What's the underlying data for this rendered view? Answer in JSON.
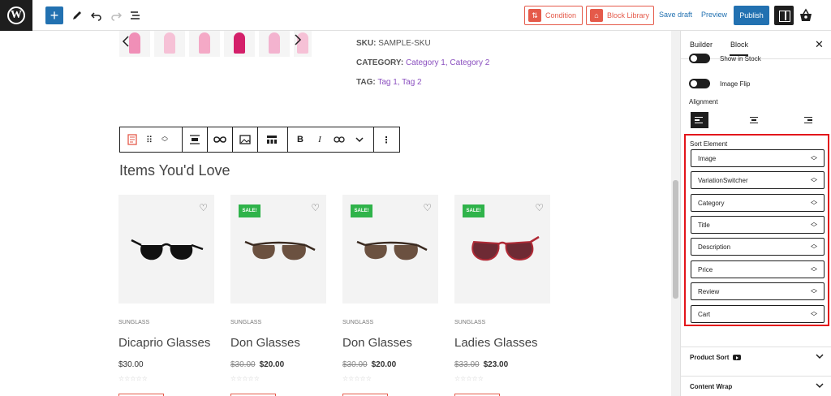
{
  "topbar": {
    "condition_label": "Condition",
    "block_library_label": "Block Library",
    "save_draft_label": "Save draft",
    "preview_label": "Preview",
    "publish_label": "Publish"
  },
  "product_meta": {
    "sku_key": "SKU:",
    "sku_value": "SAMPLE-SKU",
    "category_key": "CATEGORY:",
    "category_value": "Category 1, Category 2",
    "tag_key": "TAG:",
    "tag_value": "Tag 1, Tag 2"
  },
  "section_title": "Items You'd Love",
  "products": [
    {
      "category": "SUNGLASS",
      "name": "Dicaprio Glasses",
      "old_price": "",
      "price": "$30.00",
      "sale": false,
      "sale_label": ""
    },
    {
      "category": "SUNGLASS",
      "name": "Don Glasses",
      "old_price": "$30.00",
      "price": "$20.00",
      "sale": true,
      "sale_label": "SALE!"
    },
    {
      "category": "SUNGLASS",
      "name": "Don Glasses",
      "old_price": "$30.00",
      "price": "$20.00",
      "sale": true,
      "sale_label": "SALE!"
    },
    {
      "category": "SUNGLASS",
      "name": "Ladies Glasses",
      "old_price": "$33.00",
      "price": "$23.00",
      "sale": true,
      "sale_label": "SALE!"
    }
  ],
  "panel": {
    "tab_builder": "Builder",
    "tab_block": "Block",
    "toggle_show_in_stock": "Show in Stock",
    "toggle_image_flip": "Image Flip",
    "alignment_label": "Alignment",
    "sort_title": "Sort Element",
    "sort_items": [
      "Image",
      "VariationSwitcher",
      "Category",
      "Title",
      "Description",
      "Price",
      "Review",
      "Cart"
    ],
    "product_sort_label": "Product Sort",
    "content_wrap_label": "Content Wrap"
  },
  "colors": {
    "accent_blue": "#2271b1",
    "addon_red": "#e55a4a",
    "highlight_red": "#e3151b",
    "sale_green": "#2fb34a",
    "link_purple": "#8a4fbf"
  }
}
